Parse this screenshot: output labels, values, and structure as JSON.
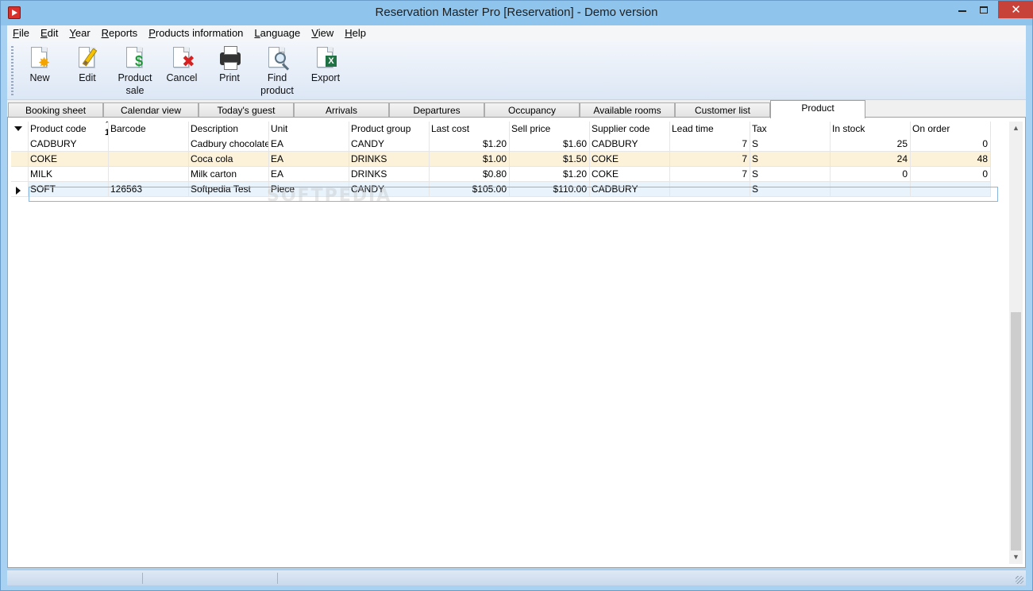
{
  "window": {
    "title": "Reservation Master Pro [Reservation] - Demo version",
    "close_glyph": "✕"
  },
  "menu": [
    {
      "u": "F",
      "rest": "ile"
    },
    {
      "u": "E",
      "rest": "dit"
    },
    {
      "u": "Y",
      "rest": "ear"
    },
    {
      "u": "R",
      "rest": "eports"
    },
    {
      "u": "P",
      "rest": "roducts information"
    },
    {
      "u": "L",
      "rest": "anguage"
    },
    {
      "u": "V",
      "rest": "iew"
    },
    {
      "u": "H",
      "rest": "elp"
    }
  ],
  "toolbar": {
    "new": "New",
    "edit": "Edit",
    "product_sale_1": "Product",
    "product_sale_2": "sale",
    "cancel": "Cancel",
    "print": "Print",
    "find_1": "Find",
    "find_2": "product",
    "export": "Export"
  },
  "tabs": [
    "Booking sheet",
    "Calendar view",
    "Today's guest",
    "Arrivals",
    "Departures",
    "Occupancy",
    "Available rooms",
    "Customer list",
    "Product"
  ],
  "grid": {
    "columns": [
      "Product code",
      "Barcode",
      "Description",
      "Unit",
      "Product group",
      "Last cost",
      "Sell price",
      "Supplier code",
      "Lead time",
      "Tax",
      "In stock",
      "On order"
    ],
    "sort_indicator": "1",
    "rows": [
      [
        "CADBURY",
        "",
        "Cadbury chocolate",
        "EA",
        "CANDY",
        "$1.20",
        "$1.60",
        "CADBURY",
        "7",
        "S",
        "25",
        "0"
      ],
      [
        "COKE",
        "",
        "Coca cola",
        "EA",
        "DRINKS",
        "$1.00",
        "$1.50",
        "COKE",
        "7",
        "S",
        "24",
        "48"
      ],
      [
        "MILK",
        "",
        "Milk carton",
        "EA",
        "DRINKS",
        "$0.80",
        "$1.20",
        "COKE",
        "7",
        "S",
        "0",
        "0"
      ],
      [
        "SOFT",
        "126563",
        "Softpedia Test",
        "Piece",
        "CANDY",
        "$105.00",
        "$110.00",
        "CADBURY",
        "",
        "S",
        "",
        ""
      ]
    ]
  },
  "watermark": "SOFTPEDIA",
  "scrollbar": {
    "up": "▲",
    "down": "▼"
  }
}
